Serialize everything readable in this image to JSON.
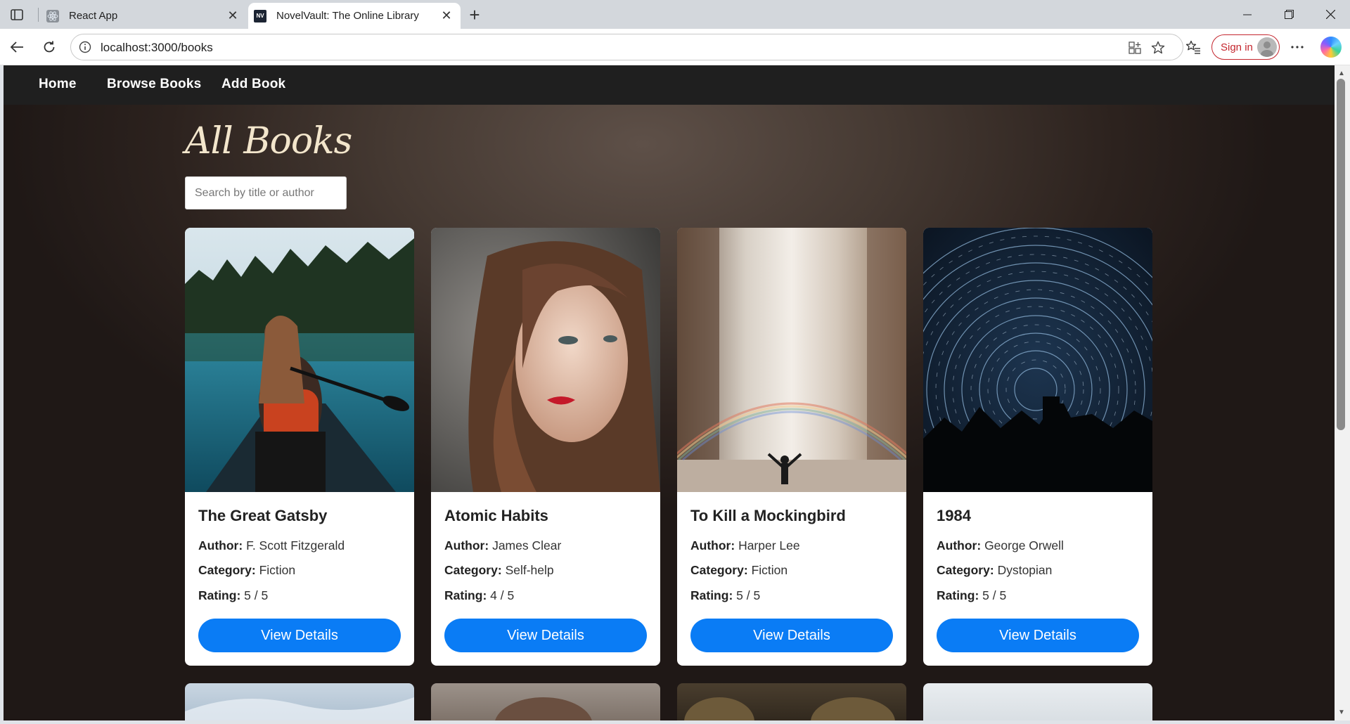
{
  "browser": {
    "tabs": [
      {
        "title": "React App",
        "active": false,
        "favicon": "react-icon"
      },
      {
        "title": "NovelVault: The Online Library",
        "active": true,
        "favicon": "nv-logo",
        "favicon_text": "NV"
      }
    ],
    "url": "localhost:3000/books",
    "sign_in_label": "Sign in"
  },
  "nav": {
    "links": [
      "Home",
      "Browse Books",
      "Add Book"
    ]
  },
  "page": {
    "title": "All Books",
    "search_placeholder": "Search by title or author",
    "labels": {
      "author": "Author:",
      "category": "Category:",
      "rating": "Rating:",
      "button": "View Details"
    },
    "books": [
      {
        "title": "The Great Gatsby",
        "author": "F. Scott Fitzgerald",
        "category": "Fiction",
        "rating": "5 / 5",
        "image": "woman-in-canoe-on-lake"
      },
      {
        "title": "Atomic Habits",
        "author": "James Clear",
        "category": "Self-help",
        "rating": "4 / 5",
        "image": "woman-portrait"
      },
      {
        "title": "To Kill a Mockingbird",
        "author": "Harper Lee",
        "category": "Fiction",
        "rating": "5 / 5",
        "image": "waterfall-with-rainbow"
      },
      {
        "title": "1984",
        "author": "George Orwell",
        "category": "Dystopian",
        "rating": "5 / 5",
        "image": "star-trails-night-sky"
      }
    ]
  },
  "colors": {
    "navbar": "#1f1f1f",
    "button": "#0a7cf5",
    "title": "#f3e6cc",
    "signin": "#c4262e"
  }
}
